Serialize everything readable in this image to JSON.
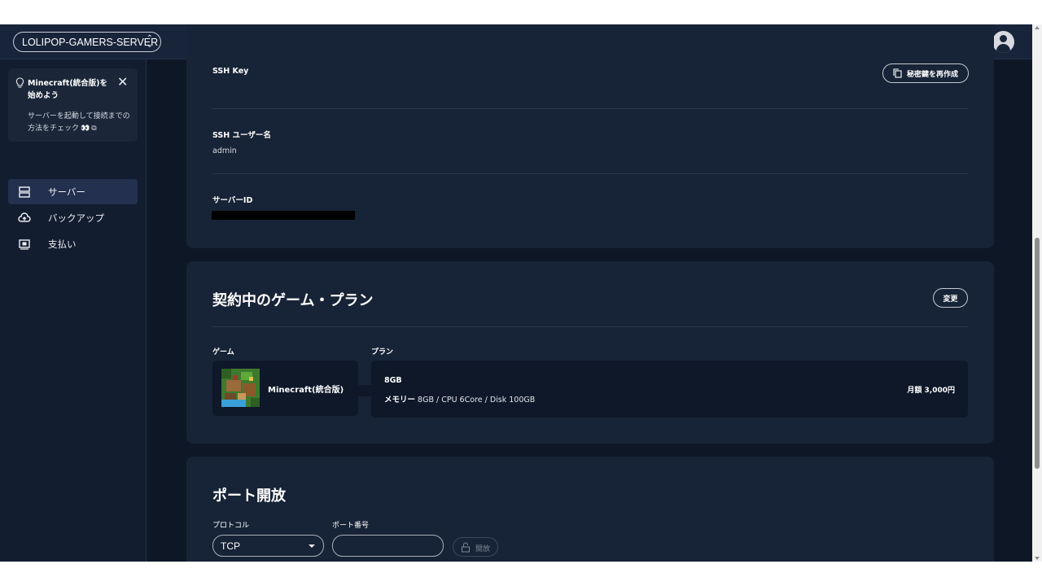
{
  "header": {
    "server_name": "LOLIPOP-GAMERS-SERVER",
    "server_select_icon": "chevron-updown-icon",
    "avatar_icon": "account-circle-icon"
  },
  "sidebar": {
    "tip": {
      "title": "Minecraft(統合版)を始めよう",
      "text": "サーバーを起動して接続までの方法をチェック",
      "icon": "lightbulb-icon"
    },
    "items": [
      {
        "label": "サーバー",
        "icon": "server-icon",
        "active": true
      },
      {
        "label": "バックアップ",
        "icon": "cloud-upload-icon",
        "active": false
      },
      {
        "label": "支払い",
        "icon": "payment-icon",
        "active": false
      }
    ]
  },
  "ssh_section": {
    "ssh_key_label": "SSH Key",
    "regen_key_button": "秘密鍵を再作成",
    "ssh_user_label": "SSH ユーザー名",
    "ssh_user_value": "admin",
    "server_id_label": "サーバーID"
  },
  "plan_section": {
    "title": "契約中のゲーム・プラン",
    "change_button": "変更",
    "game_label": "ゲーム",
    "plan_label": "プラン",
    "game_name": "Minecraft(統合版)",
    "plan_name": "8GB",
    "spec_prefix": "メモリー",
    "spec_text": "8GB / CPU 6Core / Disk 100GB",
    "price": "月額 3,000円"
  },
  "port_section": {
    "title": "ポート開放",
    "protocol_label": "プロトコル",
    "protocol_value": "TCP",
    "port_label": "ポート番号",
    "port_value": "",
    "open_button": "開放"
  },
  "colors": {
    "background": "#0d1726",
    "card": "#172336",
    "topbar": "#18243a",
    "sidebar": "#121d30",
    "active_nav": "#24304f"
  }
}
